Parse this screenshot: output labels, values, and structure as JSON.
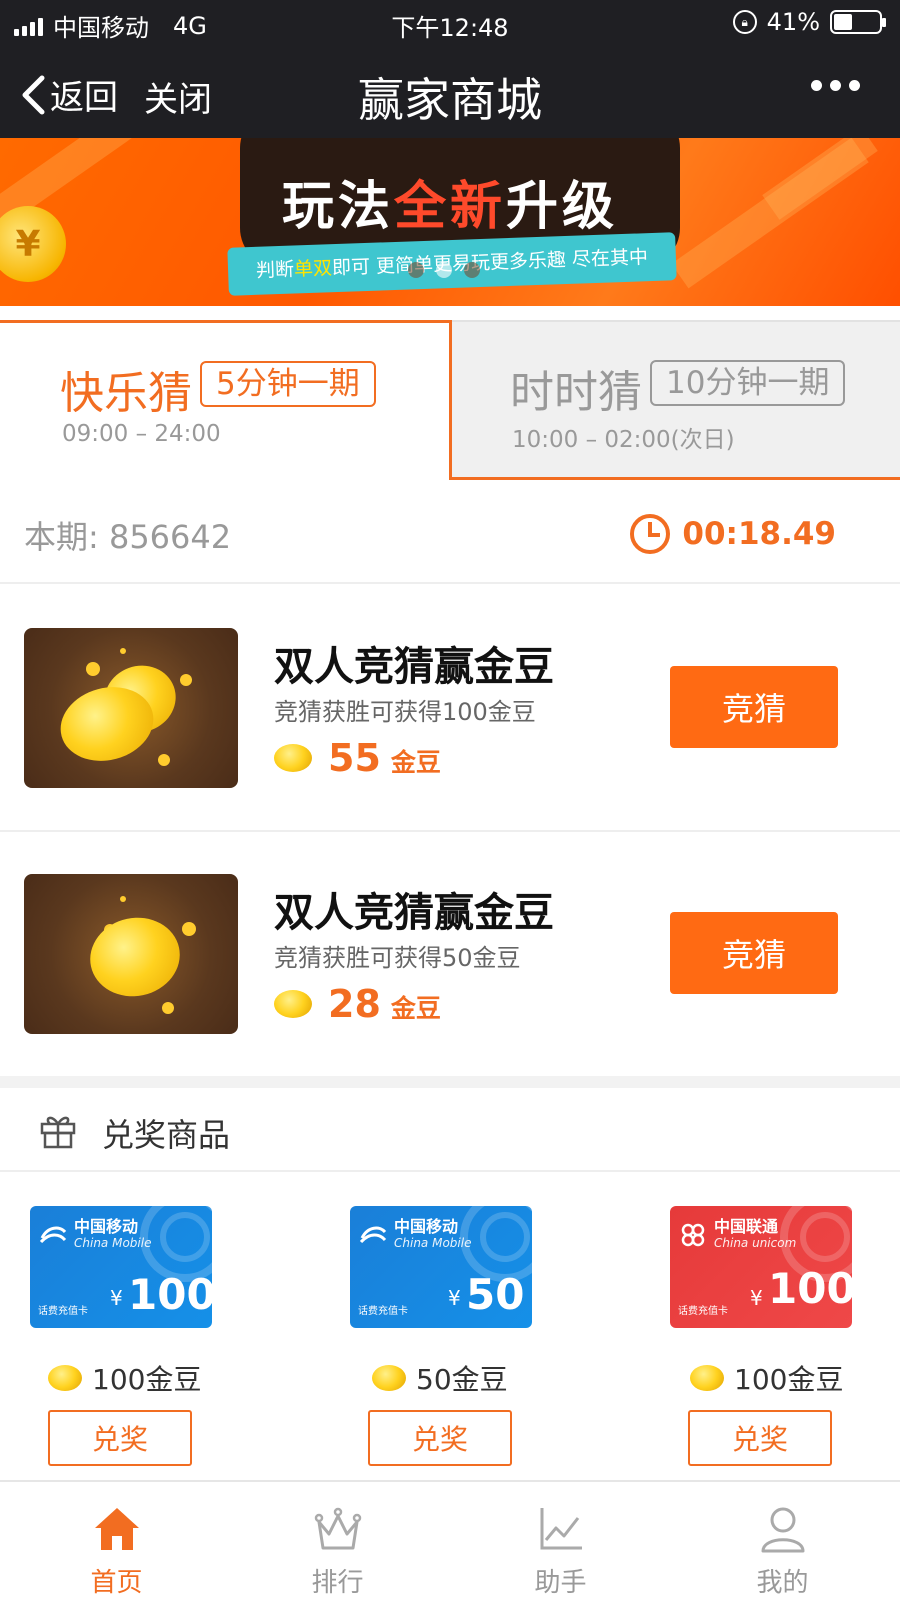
{
  "status_bar": {
    "carrier": "中国移动",
    "network": "4G",
    "time": "下午12:48",
    "battery_percent": "41%",
    "battery_level": 0.41
  },
  "nav": {
    "back_label": "返回",
    "close_label": "关闭",
    "title": "赢家商城",
    "more_icon": "more-icon"
  },
  "banner": {
    "headline_part1": "玩法",
    "headline_highlight": "全新",
    "headline_part2": "升级",
    "ribbon_part1": "判断",
    "ribbon_highlight": "单双",
    "ribbon_part2": "即可 更简单更易玩更多乐趣 尽在其中",
    "coin_symbol": "¥",
    "slide_count": 3,
    "active_slide": 2
  },
  "tabs": [
    {
      "name": "快乐猜",
      "badge": "5分钟一期",
      "hours": "09:00 – 24:00",
      "active": true
    },
    {
      "name": "时时猜",
      "badge": "10分钟一期",
      "hours": "10:00 – 02:00(次日)",
      "active": false
    }
  ],
  "period": {
    "label": "本期: 856642",
    "countdown": "00:18.49"
  },
  "games": [
    {
      "title": "双人竞猜赢金豆",
      "desc": "竞猜获胜可获得100金豆",
      "cost": "55",
      "unit": "金豆",
      "button": "竞猜"
    },
    {
      "title": "双人竞猜赢金豆",
      "desc": "竞猜获胜可获得50金豆",
      "cost": "28",
      "unit": "金豆",
      "button": "竞猜"
    }
  ],
  "prizes": {
    "heading": "兑奖商品",
    "items": [
      {
        "brand": "中国移动",
        "brand_en": "China Mobile",
        "card_type": "话费充值卡",
        "yen": "¥",
        "amount": "100",
        "cost": "100金豆",
        "button": "兑奖",
        "color": "#1a86df"
      },
      {
        "brand": "中国移动",
        "brand_en": "China Mobile",
        "card_type": "话费充值卡",
        "yen": "¥",
        "amount": "50",
        "cost": "50金豆",
        "button": "兑奖",
        "color": "#1a86df"
      },
      {
        "brand": "中国联通",
        "brand_en": "China unicom",
        "card_type": "话费充值卡",
        "yen": "¥",
        "amount": "100",
        "cost": "100金豆",
        "button": "兑奖",
        "color": "#e63a3a"
      }
    ]
  },
  "tabbar": [
    {
      "label": "首页",
      "icon": "home-icon",
      "active": true
    },
    {
      "label": "排行",
      "icon": "crown-icon",
      "active": false
    },
    {
      "label": "助手",
      "icon": "chart-icon",
      "active": false
    },
    {
      "label": "我的",
      "icon": "user-icon",
      "active": false
    }
  ],
  "colors": {
    "accent": "#f26d21",
    "button": "#ff6a13",
    "nav_bg": "#1f1f23"
  }
}
